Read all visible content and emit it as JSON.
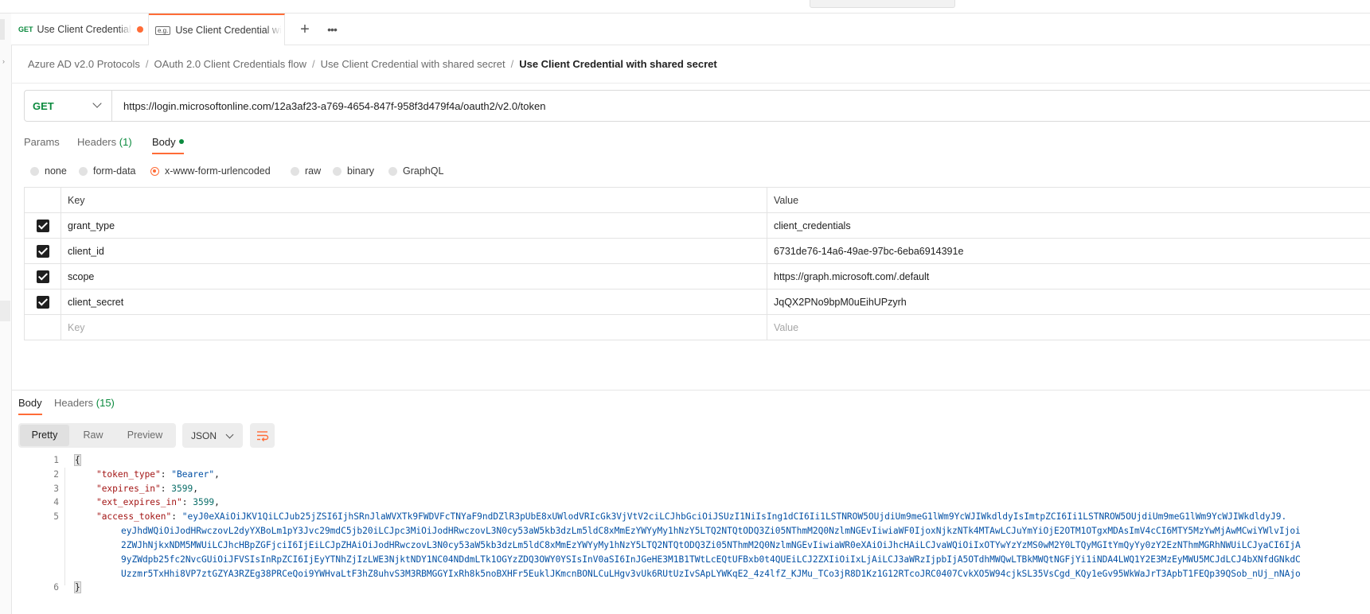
{
  "tabs": [
    {
      "method": "GET",
      "label": "Use Client Credential with shared secret",
      "unsaved": true
    },
    {
      "method_icon": "e.g.",
      "label": "Use Client Credential with shared secret"
    }
  ],
  "tab_actions": {
    "add_label": "+",
    "more_label": "•••"
  },
  "breadcrumb": {
    "items": [
      "Azure AD v2.0 Protocols",
      "OAuth 2.0 Client Credentials flow",
      "Use Client Credential with shared secret"
    ],
    "current": "Use Client Credential with shared secret",
    "separator": "/"
  },
  "request": {
    "method": "GET",
    "url": "https://login.microsoftonline.com/12a3af23-a769-4654-847f-958f3d479f4a/oauth2/v2.0/token"
  },
  "request_tabs": {
    "params": "Params",
    "headers": "Headers",
    "headers_count": "(1)",
    "body": "Body"
  },
  "body_types": [
    "none",
    "form-data",
    "x-www-form-urlencoded",
    "raw",
    "binary",
    "GraphQL"
  ],
  "body_type_selected": "x-www-form-urlencoded",
  "params_table": {
    "headers": {
      "key": "Key",
      "value": "Value"
    },
    "rows": [
      {
        "checked": true,
        "key": "grant_type",
        "value": "client_credentials"
      },
      {
        "checked": true,
        "key": "client_id",
        "value": "6731de76-14a6-49ae-97bc-6eba6914391e"
      },
      {
        "checked": true,
        "key": "scope",
        "value": "https://graph.microsoft.com/.default"
      },
      {
        "checked": true,
        "key": "client_secret",
        "value": "JqQX2PNo9bpM0uEihUPzyrh"
      }
    ],
    "placeholder": {
      "key": "Key",
      "value": "Value"
    }
  },
  "response_tabs": {
    "body": "Body",
    "headers": "Headers",
    "headers_count": "(15)"
  },
  "response_format": {
    "options": [
      "Pretty",
      "Raw",
      "Preview"
    ],
    "selected": "Pretty",
    "language": "JSON"
  },
  "response_body": {
    "line_numbers": [
      "1",
      "2",
      "3",
      "4",
      "5",
      "",
      "",
      "",
      "",
      "6"
    ],
    "open_brace": "{",
    "close_brace": "}",
    "token_type_key": "\"token_type\"",
    "token_type_value": "\"Bearer\"",
    "expires_in_key": "\"expires_in\"",
    "expires_in_value": "3599",
    "ext_expires_in_key": "\"ext_expires_in\"",
    "ext_expires_in_value": "3599",
    "access_token_key": "\"access_token\"",
    "access_token_lines": [
      "\"eyJ0eXAiOiJKV1QiLCJub25jZSI6IjhSRnJlaWVXTk9FWDVFcTNYaF9ndDZlR3pUbE8xUWlodVRIcGk3VjVtV2ciLCJhbGciOiJSUzI1NiIsIng1dCI6Ii1LSTNROW5OUjdiUm9meG1lWm9YcWJIWkdldyIsImtpZCI6Ii1LSTNROW5OUjdiUm9meG1lWm9YcWJIWkdldyJ9.",
      "eyJhdWQiOiJodHRwczovL2dyYXBoLm1pY3Jvc29mdC5jb20iLCJpc3MiOiJodHRwczovL3N0cy53aW5kb3dzLm5ldC8xMmEzYWYyMy1hNzY5LTQ2NTQtODQ3Zi05NThmM2Q0NzlmNGEvIiwiaWF0IjoxNjkzNTk4MTAwLCJuYmYiOjE2OTM1OTgxMDAsImV4cCI6MTY5MzYwMjAwMCwiYWlvIjoi",
      "2ZWJhNjkxNDM5MWUiLCJhcHBpZGFjciI6IjEiLCJpZHAiOiJodHRwczovL3N0cy53aW5kb3dzLm5ldC8xMmEzYWYyMy1hNzY5LTQ2NTQtODQ3Zi05NThmM2Q0NzlmNGEvIiwiaWR0eXAiOiJhcHAiLCJvaWQiOiIxOTYwYzYzMS0wM2Y0LTQyMGItYmQyYy0zY2EzNThmMGRhNWUiLCJyaCI6IjA",
      "9yZWdpb25fc2NvcGUiOiJFVSIsInRpZCI6IjEyYTNhZjIzLWE3NjktNDY1NC04NDdmLTk1OGYzZDQ3OWY0YSIsInV0aSI6InJGeHE3M1B1TWtLcEQtUFBxb0t4QUEiLCJ2ZXIiOiIxLjAiLCJ3aWRzIjpbIjA5OTdhMWQwLTBkMWQtNGFjYi1iNDA4LWQ1Y2E3MzEyMWU5MCJdLCJ4bXNfdGNkdC",
      "Uzzmr5TxHhi8VP7ztGZYA3RZEg38PRCeQoi9YWHvaLtF3hZ8uhvS3M3RBMGGYIxRh8k5noBXHFr5EuklJKmcnBONLCuLHgv3vUk6RUtUzIvSApLYWKqE2_4z4lfZ_KJMu_TCo3jR8D1Kz1G12RTcoJRC0407CvkXO5W94cjkSL35VsCgd_KQy1eGv95WkWaJrT3ApbT1FEQp39QSob_nUj_nNAjo"
    ]
  }
}
